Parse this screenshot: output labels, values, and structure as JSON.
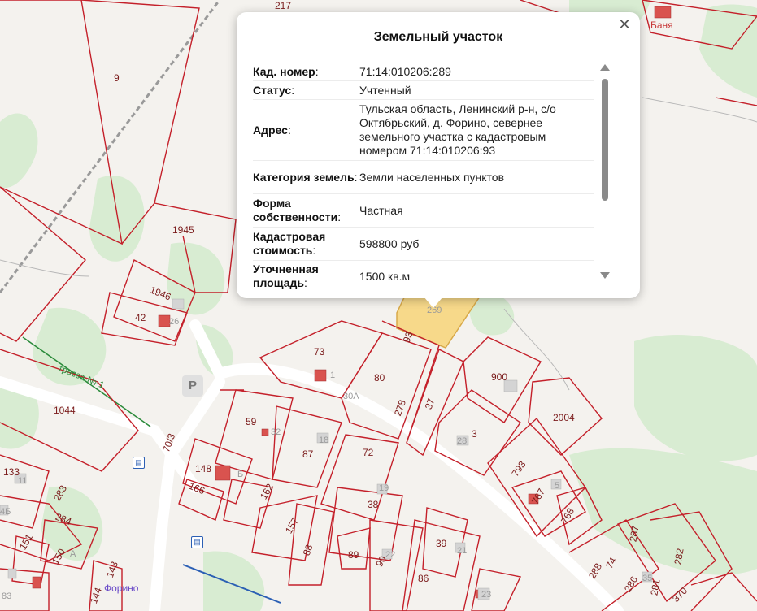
{
  "popup": {
    "title": "Земельный участок",
    "close_icon": "close-icon",
    "rows": [
      {
        "label": "Кад. номер",
        "value": "71:14:010206:289"
      },
      {
        "label": "Статус",
        "value": "Учтенный"
      },
      {
        "label": "Адрес",
        "value": "Тульская область, Ленинский р-н, с/о Октябрьский, д. Форино, севернее земельного участка с кадастровым номером 71:14:010206:93"
      },
      {
        "label": "Категория земель",
        "value": "Земли населенных пунктов"
      },
      {
        "label": "Форма собственности",
        "value": "Частная"
      },
      {
        "label": "Кадастровая стоимость",
        "value": "598800 руб"
      },
      {
        "label": "Уточненная площадь",
        "value": "1500 кв.м"
      }
    ],
    "colon": ":"
  },
  "map": {
    "bath_label": "Баня",
    "village_label": "Форино",
    "road_label": "трасса-№-1",
    "parking_label": "P",
    "bus_icon": "bus-stop-icon",
    "highlight_color": "#f7d98a",
    "boundary_color": "#c4202a",
    "parcel_labels": [
      "9",
      "1945",
      "1946",
      "42",
      "73",
      "80",
      "93",
      "278",
      "37",
      "900",
      "2004",
      "3",
      "28",
      "1044",
      "59",
      "87",
      "72",
      "148",
      "166",
      "162",
      "157",
      "38",
      "19",
      "70/3",
      "133",
      "283",
      "284",
      "151",
      "150",
      "143",
      "144",
      "88",
      "89",
      "90",
      "39",
      "86",
      "793",
      "767",
      "768",
      "287",
      "282",
      "288",
      "74",
      "286",
      "281",
      "370",
      "30А",
      "269",
      "217",
      "11",
      "32",
      "18",
      "26",
      "4Б",
      "21",
      "22",
      "23",
      "83",
      "35",
      "1",
      "А",
      "Б",
      "5"
    ]
  }
}
